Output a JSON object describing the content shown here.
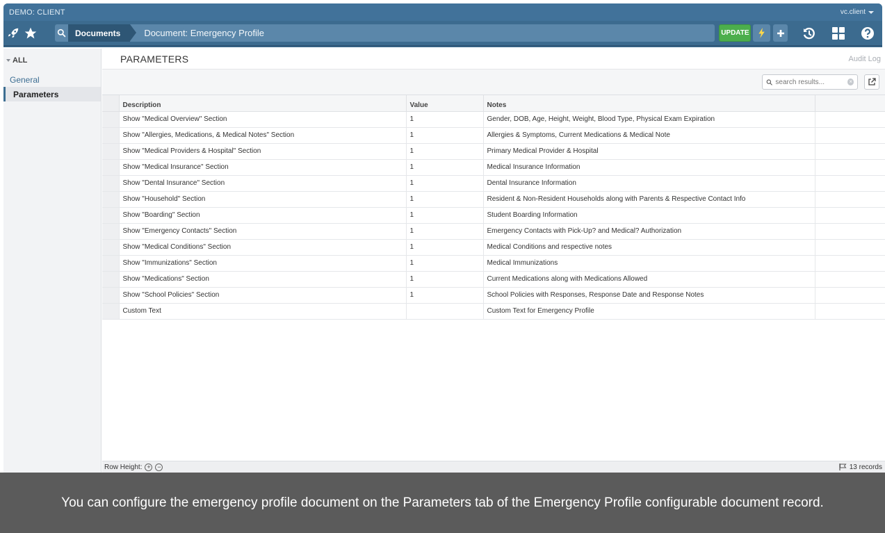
{
  "header": {
    "client_name": "DEMO: CLIENT",
    "user_name": "vc.client",
    "breadcrumbs": [
      "Documents",
      "Document: Emergency Profile"
    ],
    "update_label": "UPDATE"
  },
  "sidebar": {
    "all_label": "ALL",
    "items": [
      {
        "label": "General"
      },
      {
        "label": "Parameters"
      }
    ]
  },
  "main": {
    "title": "PARAMETERS",
    "audit_log": "Audit Log",
    "search_placeholder": "search results...",
    "columns": [
      "Description",
      "Value",
      "Notes"
    ],
    "rows": [
      {
        "description": "Show \"Medical Overview\" Section",
        "value": "1",
        "notes": "Gender, DOB, Age, Height, Weight, Blood Type, Physical Exam Expiration"
      },
      {
        "description": "Show \"Allergies, Medications, & Medical Notes\" Section",
        "value": "1",
        "notes": "Allergies & Symptoms, Current Medications & Medical Note"
      },
      {
        "description": "Show \"Medical Providers & Hospital\" Section",
        "value": "1",
        "notes": "Primary Medical Provider & Hospital"
      },
      {
        "description": "Show \"Medical Insurance\" Section",
        "value": "1",
        "notes": "Medical Insurance Information"
      },
      {
        "description": "Show \"Dental Insurance\" Section",
        "value": "1",
        "notes": "Dental Insurance Information"
      },
      {
        "description": "Show \"Household\" Section",
        "value": "1",
        "notes": "Resident & Non-Resident Households along with Parents & Respective Contact Info"
      },
      {
        "description": "Show \"Boarding\" Section",
        "value": "1",
        "notes": "Student Boarding Information"
      },
      {
        "description": "Show \"Emergency Contacts\" Section",
        "value": "1",
        "notes": "Emergency Contacts with Pick-Up? and Medical? Authorization"
      },
      {
        "description": "Show \"Medical Conditions\" Section",
        "value": "1",
        "notes": "Medical Conditions and respective notes"
      },
      {
        "description": "Show \"Immunizations\" Section",
        "value": "1",
        "notes": "Medical Immunizations"
      },
      {
        "description": "Show \"Medications\" Section",
        "value": "1",
        "notes": "Current Medications along with Medications Allowed"
      },
      {
        "description": "Show \"School Policies\" Section",
        "value": "1",
        "notes": "School Policies with Responses, Response Date and Response Notes"
      },
      {
        "description": "Custom Text",
        "value": "",
        "notes": "Custom Text for Emergency Profile"
      }
    ],
    "row_height_label": "Row Height:",
    "record_count": "13 records"
  },
  "caption": {
    "text": "You can configure the emergency profile document on the Parameters tab of the  Emergency Profile configurable document record."
  },
  "colors": {
    "header_blue": "#3d6e92",
    "update_green": "#4cae4c",
    "caption_gray": "#5b5b5b"
  },
  "icons": [
    "rocket-icon",
    "star-icon",
    "search-icon",
    "bolt-icon",
    "plus-icon",
    "history-icon",
    "grid-icon",
    "help-icon",
    "external-link-icon",
    "flag-icon"
  ]
}
